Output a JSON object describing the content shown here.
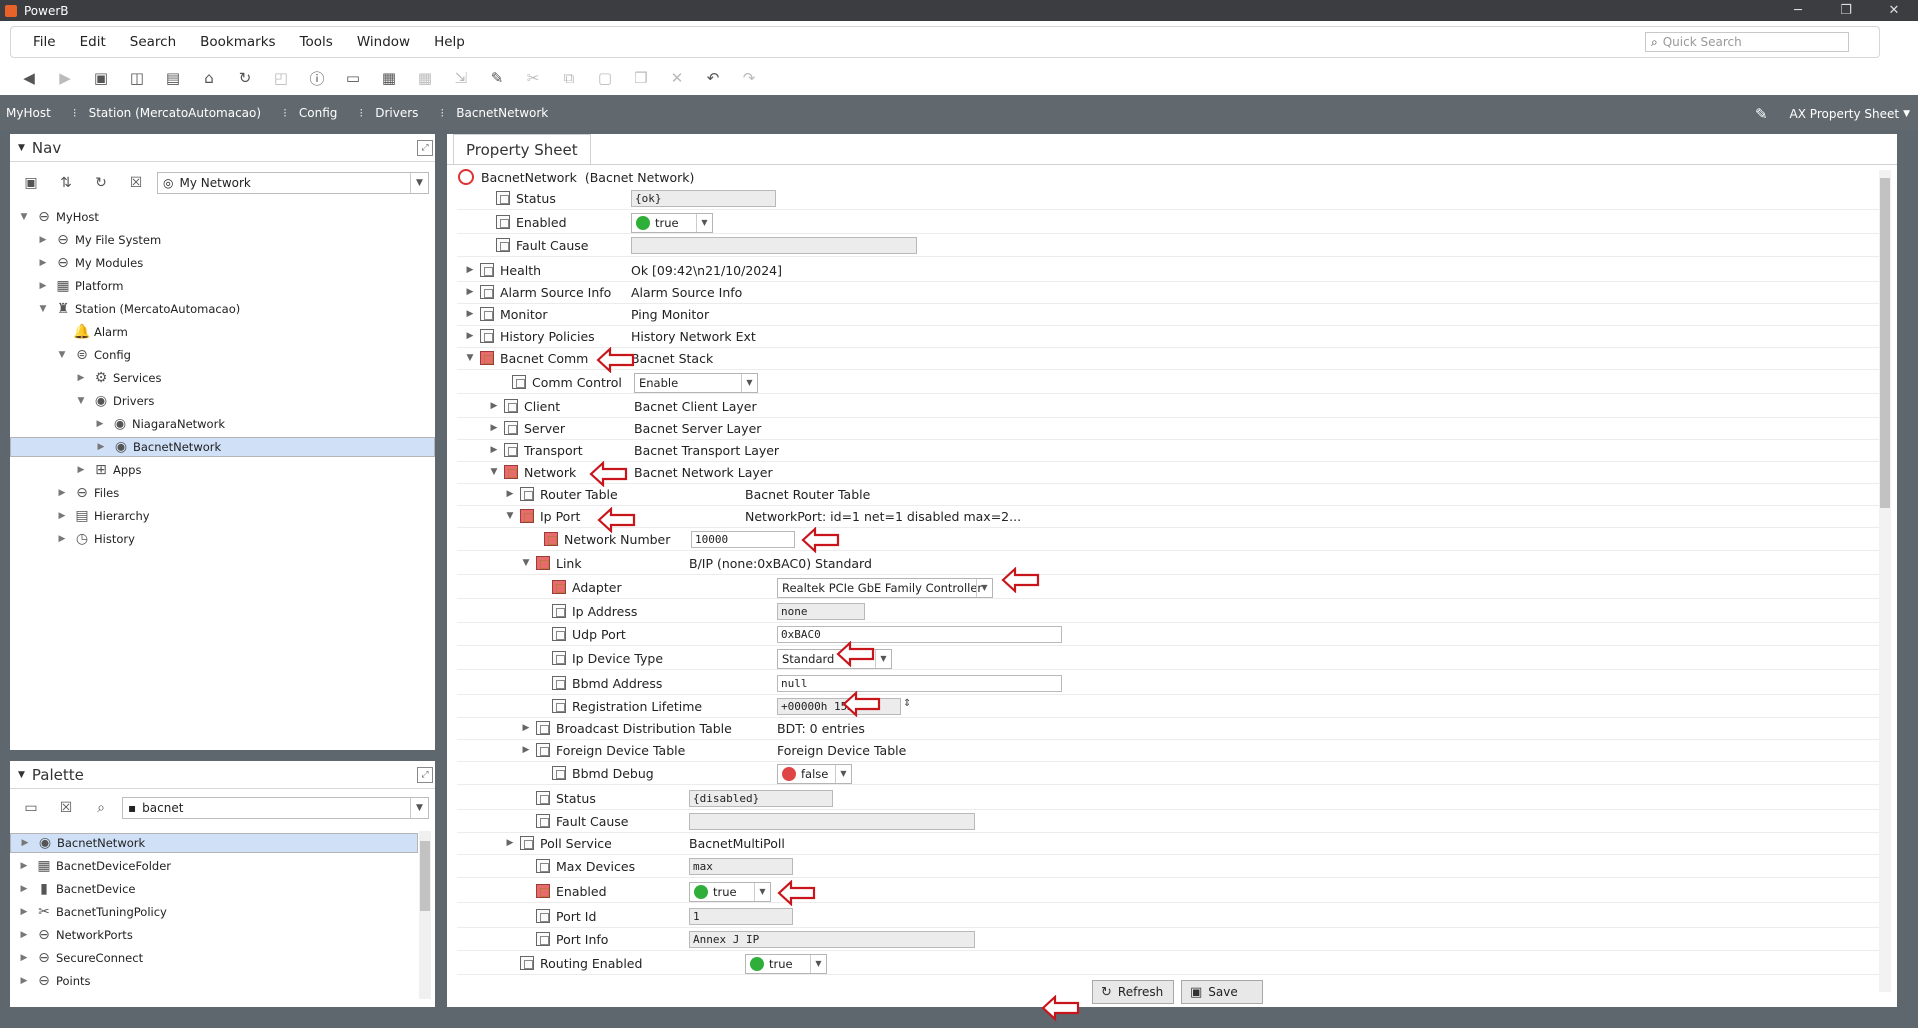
{
  "window": {
    "title": "PowerB",
    "min": "─",
    "restore": "❐",
    "close": "✕"
  },
  "menu": [
    "File",
    "Edit",
    "Search",
    "Bookmarks",
    "Tools",
    "Window",
    "Help"
  ],
  "quick_search_placeholder": "Quick Search",
  "breadcrumb": [
    "MyHost",
    "Station (MercatoAutomacao)",
    "Config",
    "Drivers",
    "BacnetNetwork"
  ],
  "view_selector": "AX Property Sheet",
  "nav": {
    "title": "Nav",
    "network_select": "My Network",
    "tree": [
      {
        "label": "MyHost",
        "icon": "host-icon"
      },
      {
        "label": "My File System",
        "icon": "filesystem-icon"
      },
      {
        "label": "My Modules",
        "icon": "modules-icon"
      },
      {
        "label": "Platform",
        "icon": "platform-icon"
      },
      {
        "label": "Station (MercatoAutomacao)",
        "icon": "station-icon"
      },
      {
        "label": "Alarm",
        "icon": "alarm-icon"
      },
      {
        "label": "Config",
        "icon": "config-icon"
      },
      {
        "label": "Services",
        "icon": "services-icon"
      },
      {
        "label": "Drivers",
        "icon": "drivers-icon"
      },
      {
        "label": "NiagaraNetwork",
        "icon": "network-icon"
      },
      {
        "label": "BacnetNetwork",
        "icon": "network-icon"
      },
      {
        "label": "Apps",
        "icon": "apps-icon"
      },
      {
        "label": "Files",
        "icon": "files-icon"
      },
      {
        "label": "Hierarchy",
        "icon": "hierarchy-icon"
      },
      {
        "label": "History",
        "icon": "history-icon"
      }
    ]
  },
  "palette": {
    "title": "Palette",
    "module_select": "bacnet",
    "items": [
      {
        "label": "BacnetNetwork"
      },
      {
        "label": "BacnetDeviceFolder"
      },
      {
        "label": "BacnetDevice"
      },
      {
        "label": "BacnetTuningPolicy"
      },
      {
        "label": "NetworkPorts"
      },
      {
        "label": "SecureConnect"
      },
      {
        "label": "Points"
      }
    ]
  },
  "sheet": {
    "tab": "Property Sheet",
    "root_name": "BacnetNetwork",
    "root_type": "(Bacnet Network)",
    "rows": [
      {
        "label": "Status",
        "value": "{ok}"
      },
      {
        "label": "Enabled",
        "value": "true"
      },
      {
        "label": "Fault Cause",
        "value": ""
      },
      {
        "label": "Health",
        "value": "Ok [09:42\\n21/10/2024]"
      },
      {
        "label": "Alarm Source Info",
        "value": "Alarm Source Info"
      },
      {
        "label": "Monitor",
        "value": "Ping Monitor"
      },
      {
        "label": "History Policies",
        "value": "History Network Ext"
      },
      {
        "label": "Bacnet Comm",
        "value": "Bacnet Stack"
      },
      {
        "label": "Comm Control",
        "value": "Enable"
      },
      {
        "label": "Client",
        "value": "Bacnet Client Layer"
      },
      {
        "label": "Server",
        "value": "Bacnet Server Layer"
      },
      {
        "label": "Transport",
        "value": "Bacnet Transport Layer"
      },
      {
        "label": "Network",
        "value": "Bacnet Network Layer"
      },
      {
        "label": "Router Table",
        "value": "Bacnet Router Table"
      },
      {
        "label": "Ip Port",
        "value": "NetworkPort: id=1 net=1 disabled max=2..."
      },
      {
        "label": "Network Number",
        "value": "10000"
      },
      {
        "label": "Link",
        "value": "B/IP (none:0xBAC0) Standard"
      },
      {
        "label": "Adapter",
        "value": "Realtek PCIe GbE Family Controller"
      },
      {
        "label": "Ip Address",
        "value": "none"
      },
      {
        "label": "Udp Port",
        "value": "0xBAC0"
      },
      {
        "label": "Ip Device Type",
        "value": "Standard"
      },
      {
        "label": "Bbmd Address",
        "value": "null"
      },
      {
        "label": "Registration Lifetime",
        "value": "+00000h 15m 00s"
      },
      {
        "label": "Broadcast Distribution Table",
        "value": "BDT: 0 entries"
      },
      {
        "label": "Foreign Device Table",
        "value": "Foreign Device Table"
      },
      {
        "label": "Bbmd Debug",
        "value": "false"
      },
      {
        "label": "Status",
        "value": "{disabled}"
      },
      {
        "label": "Fault Cause",
        "value": ""
      },
      {
        "label": "Poll Service",
        "value": "BacnetMultiPoll"
      },
      {
        "label": "Max Devices",
        "value": "max"
      },
      {
        "label": "Enabled",
        "value": "true"
      },
      {
        "label": "Port Id",
        "value": "1"
      },
      {
        "label": "Port Info",
        "value": "Annex J IP"
      },
      {
        "label": "Routing Enabled",
        "value": "true"
      }
    ],
    "refresh_label": "Refresh",
    "save_label": "Save"
  },
  "colors": {
    "accent_arrow": "#c8151b",
    "selection": "#cfe0f7",
    "status_green": "#2fae3a",
    "status_red": "#e04545"
  }
}
